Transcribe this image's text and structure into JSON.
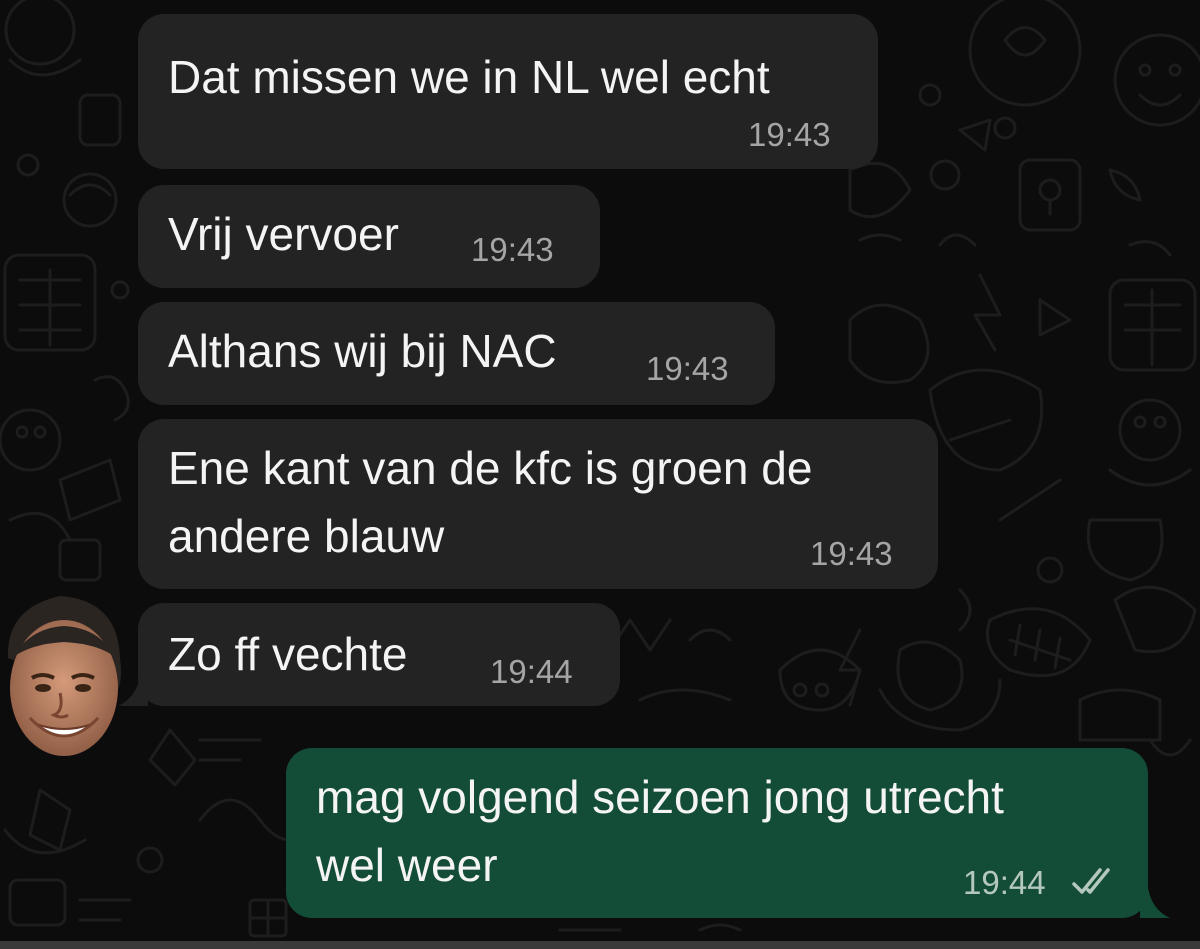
{
  "messages": [
    {
      "text": "Dat missen we in NL wel echt",
      "time": "19:43",
      "direction": "incoming"
    },
    {
      "text": "Vrij vervoer",
      "time": "19:43",
      "direction": "incoming"
    },
    {
      "text": "Althans wij bij NAC",
      "time": "19:43",
      "direction": "incoming"
    },
    {
      "text_lines": [
        "Ene kant van de kfc is groen de",
        "andere blauw"
      ],
      "time": "19:43",
      "direction": "incoming"
    },
    {
      "text": "Zo ff vechte",
      "time": "19:44",
      "direction": "incoming"
    },
    {
      "text_lines": [
        "mag volgend seizoen jong utrecht",
        "wel weer"
      ],
      "time": "19:44",
      "direction": "outgoing",
      "status_icon": "double-check-icon"
    }
  ],
  "colors": {
    "background": "#0c0c0c",
    "incoming_bubble": "#232323",
    "outgoing_bubble": "#144d37",
    "timestamp": "#a5a5a5"
  },
  "sender_avatar": {
    "icon": "avatar"
  }
}
